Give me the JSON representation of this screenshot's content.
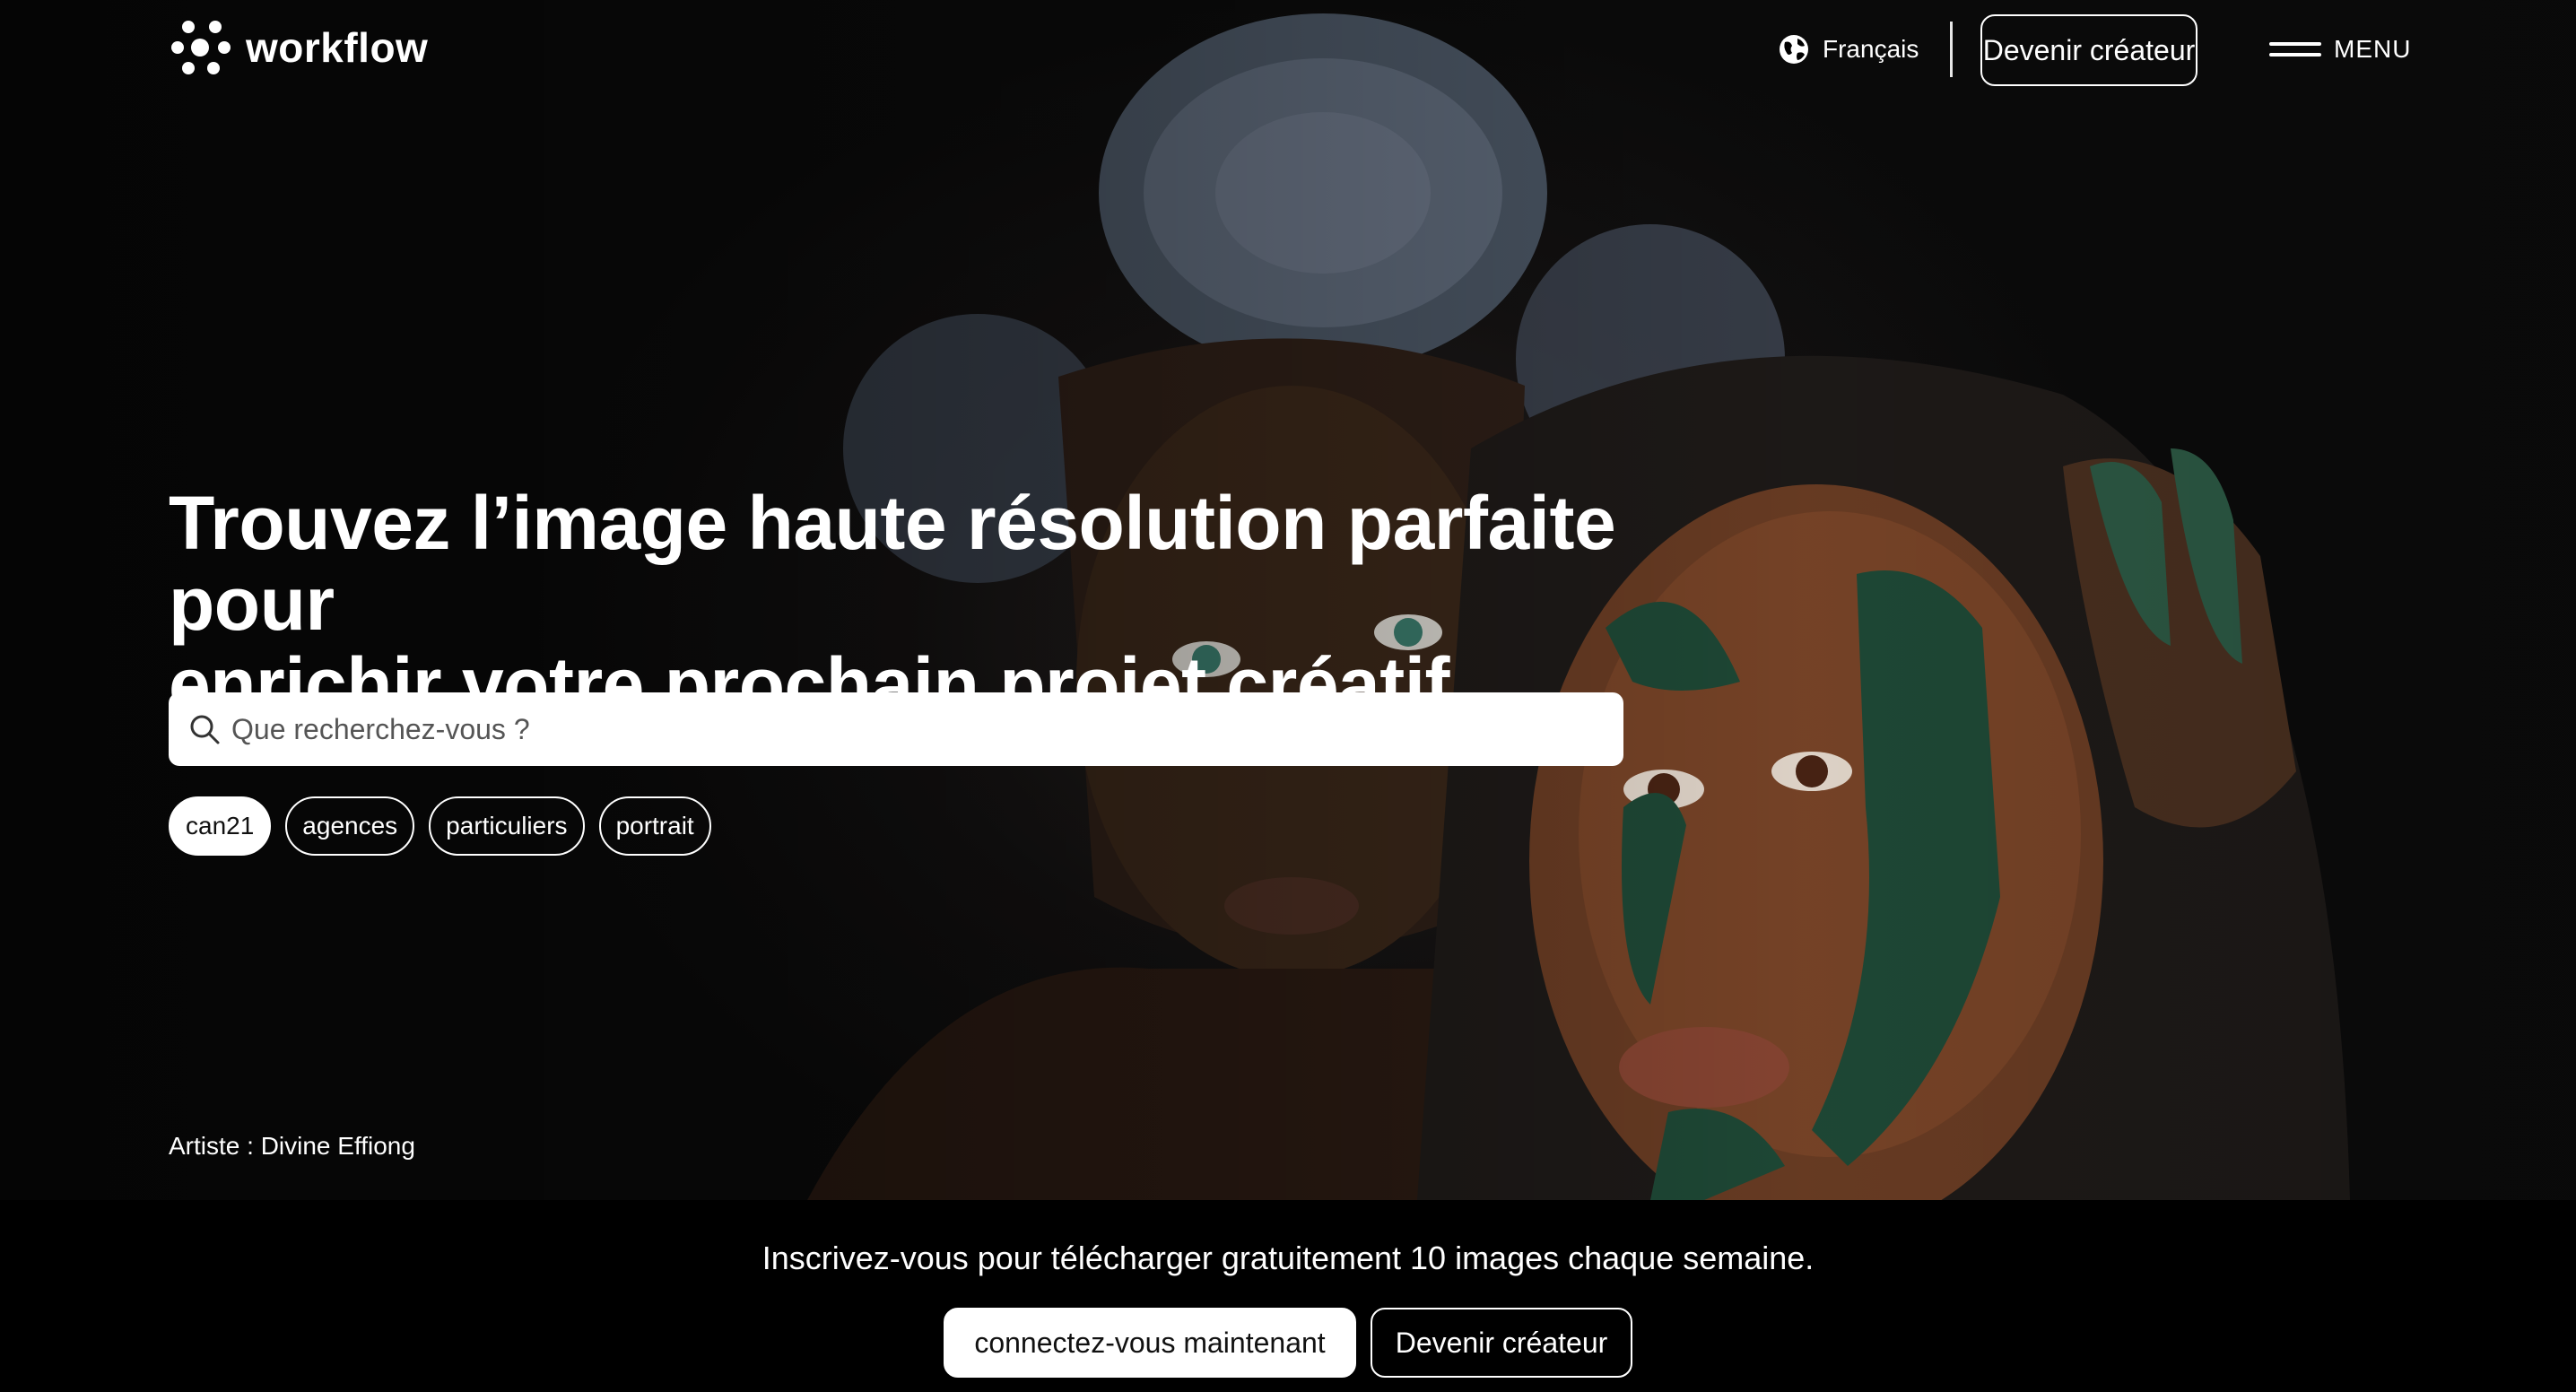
{
  "brand": {
    "name": "workflow"
  },
  "header": {
    "language_label": "Français",
    "creator_button": "Devenir créateur",
    "menu_label": "MENU"
  },
  "hero": {
    "headline_line1": "Trouvez l’image haute résolution parfaite pour",
    "headline_line2": "enrichir votre prochain projet créatif.",
    "search_placeholder": "Que recherchez-vous ?",
    "tags": [
      {
        "label": "can21",
        "active": true
      },
      {
        "label": "agences",
        "active": false
      },
      {
        "label": "particuliers",
        "active": false
      },
      {
        "label": "portrait",
        "active": false
      }
    ],
    "credit": "Artiste : Divine Effiong"
  },
  "banner": {
    "message": "Inscrivez-vous pour télécharger gratuitement 10 images chaque semaine.",
    "connect_button": "connectez-vous maintenant",
    "creator_button": "Devenir créateur"
  },
  "icons": {
    "logo": "workflow-logo-icon",
    "language": "globe-icon",
    "menu": "hamburger-icon",
    "search": "search-icon"
  },
  "colors": {
    "background": "#000000",
    "text": "#ffffff",
    "search_bg": "#ffffff",
    "paint_green": "#1f4a37"
  }
}
